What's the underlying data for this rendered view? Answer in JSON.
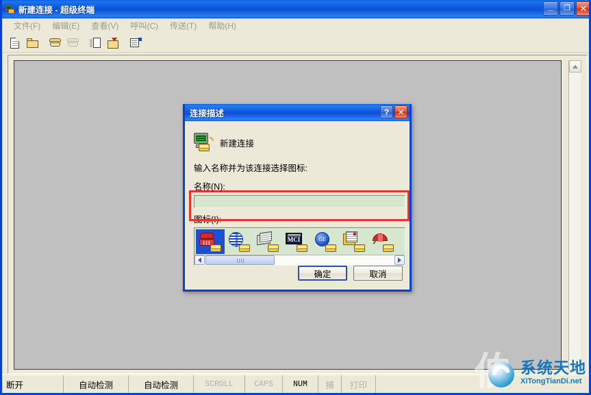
{
  "window": {
    "title": "新建连接 - 超级终端",
    "icon": "modem-connection-icon",
    "controls": {
      "minimize": "_",
      "maximize": "❐",
      "close": "✕"
    }
  },
  "menubar": {
    "items": [
      {
        "label": "文件(F)"
      },
      {
        "label": "编辑(E)"
      },
      {
        "label": "查看(V)"
      },
      {
        "label": "呼叫(C)"
      },
      {
        "label": "传送(T)"
      },
      {
        "label": "帮助(H)"
      }
    ]
  },
  "toolbar": {
    "buttons": [
      {
        "name": "new-connection-icon"
      },
      {
        "name": "open-file-icon"
      },
      {
        "name": "call-icon"
      },
      {
        "name": "hangup-icon"
      },
      {
        "name": "send-file-icon"
      },
      {
        "name": "receive-file-icon"
      },
      {
        "name": "properties-icon"
      }
    ]
  },
  "dialog": {
    "title": "连接描述",
    "help_button": "?",
    "close_button": "✕",
    "header_caption": "新建连接",
    "prompt": "输入名称并为该连接选择图标:",
    "name_label": "名称(N):",
    "name_value": "",
    "name_placeholder": "",
    "icon_label": "图标(I):",
    "icons": [
      {
        "name": "red-telephone-icon",
        "selected": true
      },
      {
        "name": "blue-globe-icon",
        "selected": false
      },
      {
        "name": "newspaper-icon",
        "selected": false
      },
      {
        "name": "mci-logo-icon",
        "label": "MCI",
        "selected": false
      },
      {
        "name": "ge-globe-icon",
        "label": "GE",
        "selected": false
      },
      {
        "name": "documents-icon",
        "selected": false
      },
      {
        "name": "red-umbrella-icon",
        "selected": false
      }
    ],
    "scroll_left": "‹",
    "scroll_right": "›",
    "ok_button": "确定",
    "cancel_button": "取消",
    "highlight_color": "#e8332a",
    "field_color": "#d6e6cf"
  },
  "statusbar": {
    "connection": "断开",
    "detect1": "自动检测",
    "detect2": "自动检测",
    "scroll": "SCROLL",
    "caps": "CAPS",
    "num": "NUM",
    "capture": "捕",
    "print": "打印"
  },
  "watermark": {
    "cn": "系统天地",
    "en": "XiTongTianDi.net",
    "ghost": "伯"
  },
  "colors": {
    "title_blue": "#0b58dd",
    "dialog_face": "#ece9d8",
    "terminal_bg": "#c0c0c0",
    "watermark_blue": "#1275bd"
  }
}
